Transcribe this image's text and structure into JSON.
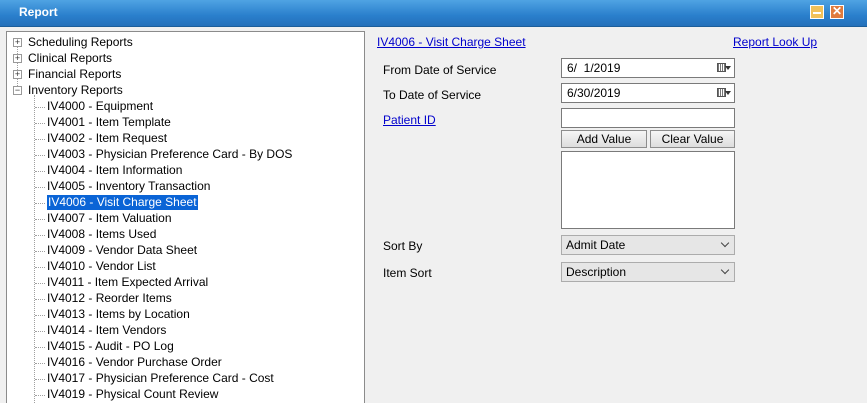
{
  "window": {
    "title": "Report"
  },
  "tree": {
    "roots": [
      {
        "label": "Scheduling Reports",
        "expanded": false
      },
      {
        "label": "Clinical Reports",
        "expanded": false
      },
      {
        "label": "Financial Reports",
        "expanded": false
      },
      {
        "label": "Inventory Reports",
        "expanded": true
      }
    ],
    "inventory_items": [
      "IV4000 - Equipment",
      "IV4001 - Item Template",
      "IV4002 - Item Request",
      "IV4003 - Physician Preference Card - By DOS",
      "IV4004 - Item Information",
      "IV4005 - Inventory Transaction",
      "IV4006 - Visit Charge Sheet",
      "IV4007 - Item Valuation",
      "IV4008 - Items Used",
      "IV4009 - Vendor Data Sheet",
      "IV4010 - Vendor List",
      "IV4011 - Item Expected Arrival",
      "IV4012 - Reorder Items",
      "IV4013 - Items by Location",
      "IV4014 - Item Vendors",
      "IV4015 - Audit - PO Log",
      "IV4016 - Vendor Purchase Order",
      "IV4017 - Physician Preference Card - Cost",
      "IV4019 - Physical Count Review"
    ],
    "selected_index": 6
  },
  "report": {
    "title_link": "IV4006 - Visit Charge Sheet",
    "lookup_link": "Report Look Up",
    "from_date_label": "From Date of Service",
    "from_date_value": "6/  1/2019",
    "to_date_label": "To Date of Service",
    "to_date_value": "6/30/2019",
    "patient_id_label": "Patient ID",
    "patient_id_value": "",
    "add_value_button": "Add Value",
    "clear_value_button": "Clear Value",
    "sort_by_label": "Sort By",
    "sort_by_value": "Admit Date",
    "item_sort_label": "Item Sort",
    "item_sort_value": "Description"
  }
}
